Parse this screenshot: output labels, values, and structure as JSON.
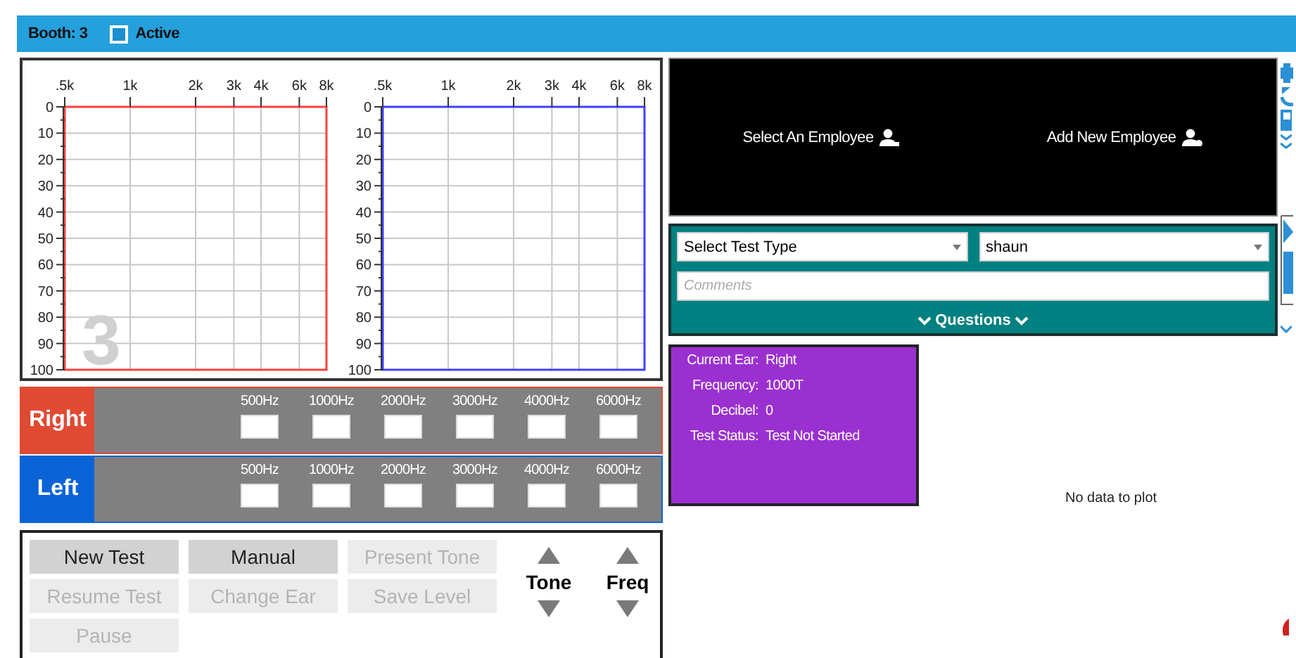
{
  "header": {
    "booth_label": "Booth: 3",
    "active": {
      "label": "Active",
      "checked": true
    }
  },
  "audiograms": [
    {
      "color": "#ff4040",
      "overlay": "3",
      "x_labels": [
        ".5k",
        "1k",
        "2k",
        "3k",
        "4k",
        "6k",
        "8k"
      ],
      "y_labels": [
        "0",
        "10",
        "20",
        "30",
        "40",
        "50",
        "60",
        "70",
        "80",
        "90",
        "100"
      ]
    },
    {
      "color": "#4040ff",
      "x_labels": [
        ".5k",
        "1k",
        "2k",
        "3k",
        "4k",
        "6k",
        "8k"
      ],
      "y_labels": [
        "0",
        "10",
        "20",
        "30",
        "40",
        "50",
        "60",
        "70",
        "80",
        "90",
        "100"
      ]
    }
  ],
  "ears": [
    {
      "label": "Right",
      "color": "#e04a33",
      "frequencies": [
        "500Hz",
        "1000Hz",
        "2000Hz",
        "3000Hz",
        "4000Hz",
        "6000Hz"
      ]
    },
    {
      "label": "Left",
      "color": "#0a64d8",
      "frequencies": [
        "500Hz",
        "1000Hz",
        "2000Hz",
        "3000Hz",
        "4000Hz",
        "6000Hz"
      ]
    }
  ],
  "controls": {
    "buttons": [
      {
        "label": "New Test",
        "disabled": false
      },
      {
        "label": "Manual",
        "disabled": false
      },
      {
        "label": "Present Tone",
        "disabled": true
      },
      {
        "label": "Resume Test",
        "disabled": true
      },
      {
        "label": "Change Ear",
        "disabled": true
      },
      {
        "label": "Save Level",
        "disabled": true
      },
      {
        "label": "Pause",
        "disabled": true
      }
    ],
    "steppers": [
      {
        "label": "Tone"
      },
      {
        "label": "Freq"
      }
    ]
  },
  "employee_panel": {
    "buttons": [
      {
        "label": "Select An Employee",
        "kind": "select"
      },
      {
        "label": "Add New Employee",
        "kind": "add"
      }
    ]
  },
  "test_form": {
    "test_type": {
      "value": "Select Test Type"
    },
    "employee": {
      "value": "shaun"
    },
    "comments": {
      "placeholder": "Comments"
    },
    "questions_toggle": "Questions"
  },
  "status": [
    {
      "label": "Current Ear:",
      "value": "Right"
    },
    {
      "label": "Frequency:",
      "value": "1000T"
    },
    {
      "label": "Decibel:",
      "value": "0"
    },
    {
      "label": "Test Status:",
      "value": "Test Not Started"
    }
  ],
  "plot_message": "No data to plot"
}
